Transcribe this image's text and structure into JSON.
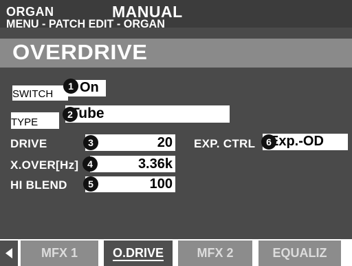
{
  "header": {
    "mode": "ORGAN",
    "patch": "MANUAL",
    "path": "MENU - PATCH EDIT - ORGAN",
    "title": "OVERDRIVE"
  },
  "params": {
    "switch": {
      "label": "SWITCH",
      "badge": "1",
      "value": "On"
    },
    "type": {
      "label": "TYPE",
      "badge": "2",
      "value": "Tube"
    },
    "drive": {
      "label": "DRIVE",
      "badge": "3",
      "value": "20"
    },
    "xover": {
      "label": "X.OVER[Hz]",
      "badge": "4",
      "value": "3.36k"
    },
    "hiblend": {
      "label": "HI BLEND",
      "badge": "5",
      "value": "100"
    },
    "expctrl": {
      "label": "EXP. CTRL",
      "badge": "6",
      "value": "Exp.-OD"
    }
  },
  "tabs": [
    {
      "label": "MFX 1",
      "active": false
    },
    {
      "label": "O.DRIVE",
      "active": true
    },
    {
      "label": "MFX 2",
      "active": false
    },
    {
      "label": "EQUALIZ",
      "active": false
    }
  ],
  "icons": {
    "left_arrow": "left-arrow-icon"
  }
}
